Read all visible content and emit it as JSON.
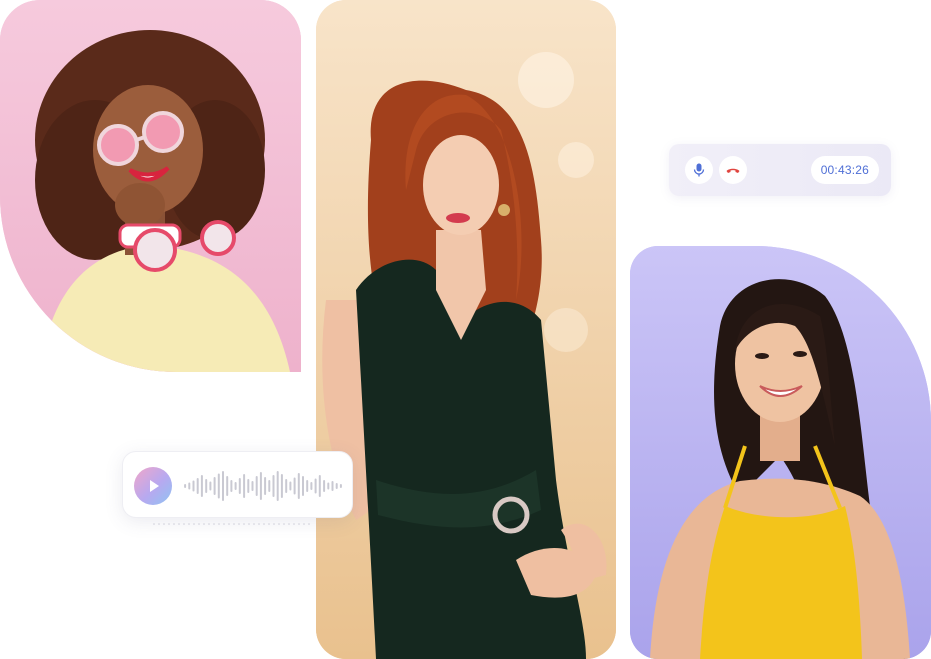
{
  "call_bar": {
    "timer": "00:43:26",
    "mic_icon": "microphone-icon",
    "hangup_icon": "phone-hangup-icon",
    "mic_color": "#4f6fd6",
    "hangup_color": "#e0443e"
  },
  "voice_message": {
    "play_icon": "play-icon",
    "waveform_bars": [
      4,
      7,
      11,
      16,
      22,
      14,
      9,
      18,
      25,
      30,
      20,
      12,
      8,
      16,
      24,
      14,
      10,
      20,
      28,
      18,
      12,
      22,
      30,
      24,
      14,
      9,
      17,
      26,
      20,
      12,
      8,
      15,
      22,
      12,
      7,
      10,
      6,
      4
    ]
  },
  "colors": {
    "accent": "#4f6fd6",
    "card_pink": "#f3bcd3",
    "card_peach": "#f2d2a7",
    "card_lilac": "#b8b1f1"
  }
}
